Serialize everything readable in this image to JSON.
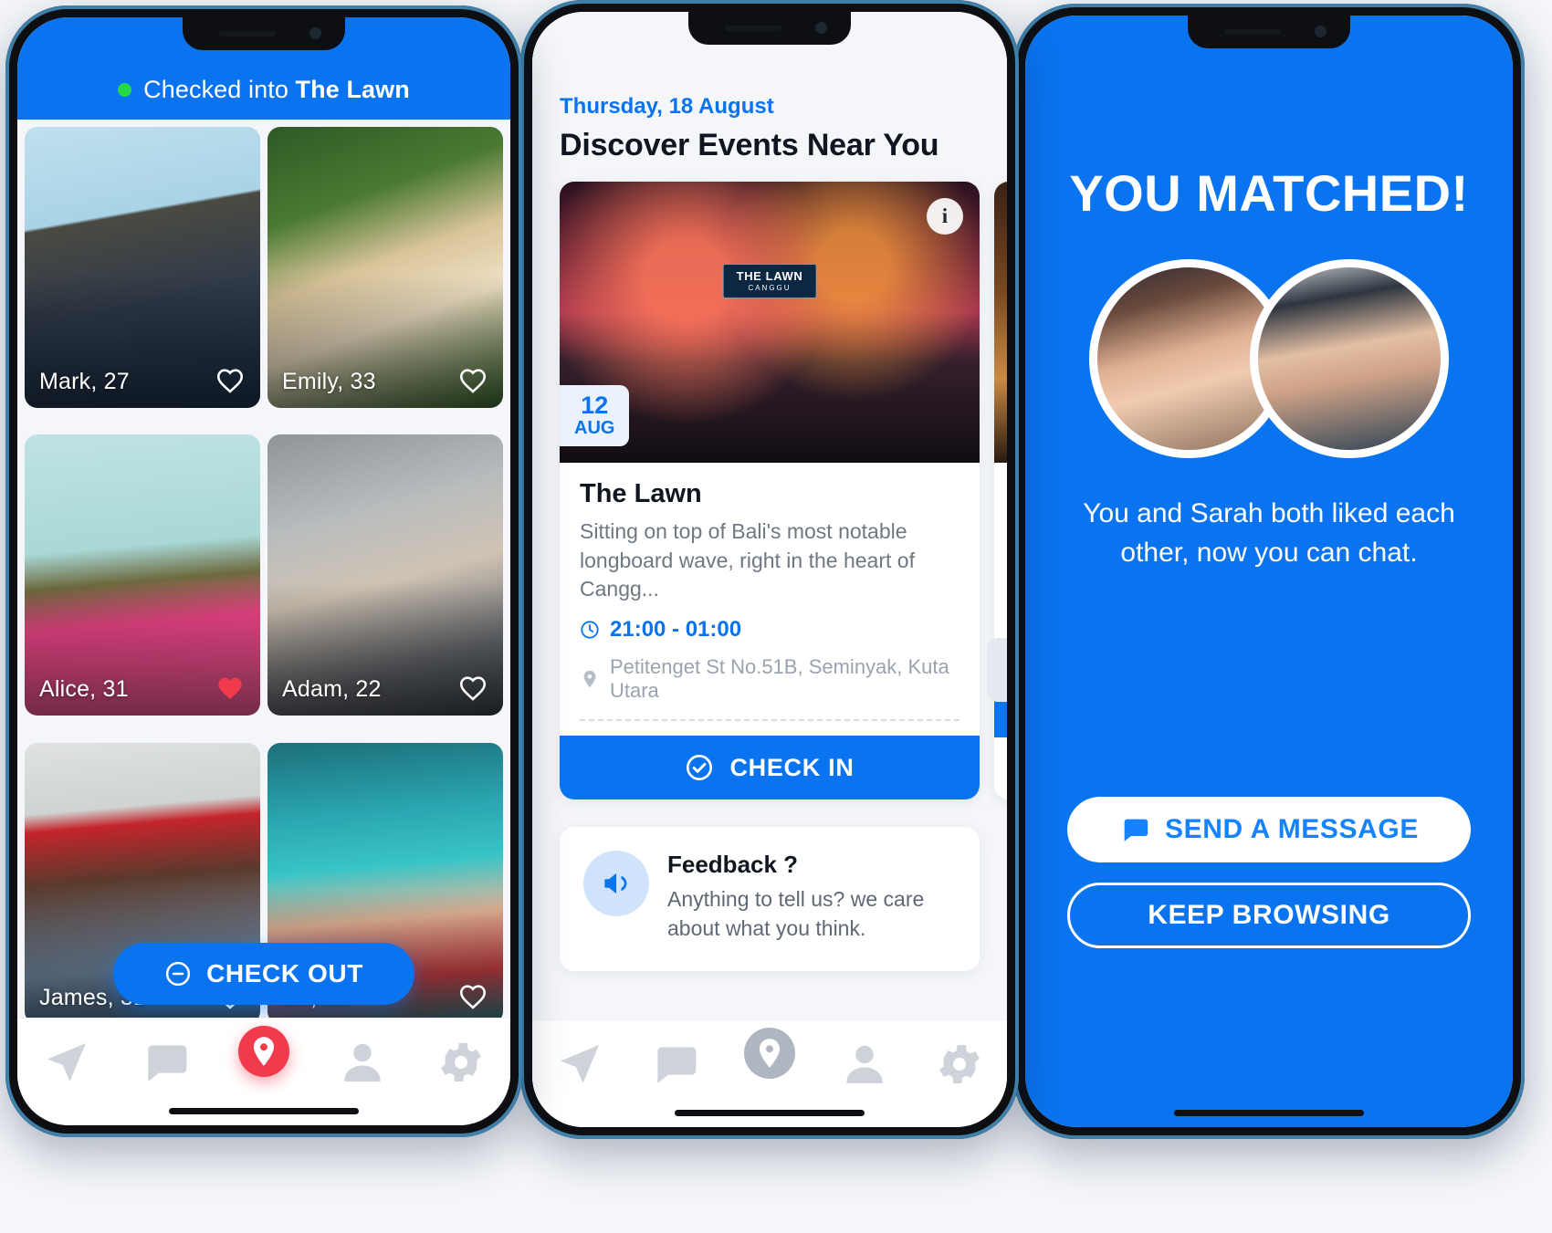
{
  "colors": {
    "brand_blue": "#0a74f0",
    "accent_red": "#f23a4d",
    "status_green": "#26d94a",
    "bg_gray": "#f4f6f9"
  },
  "phone1": {
    "header": {
      "status_prefix": "Checked into",
      "venue": "The Lawn",
      "dot": "status-dot"
    },
    "profiles": [
      {
        "name": "Mark, 27",
        "liked": false,
        "photo": "ph-mark"
      },
      {
        "name": "Emily, 33",
        "liked": false,
        "photo": "ph-emily"
      },
      {
        "name": "Alice, 31",
        "liked": true,
        "photo": "ph-alice"
      },
      {
        "name": "Adam, 22",
        "liked": false,
        "photo": "ph-adam"
      },
      {
        "name": "James, 31",
        "liked": false,
        "photo": "ph-james"
      },
      {
        "name": "Sri, 22",
        "liked": false,
        "photo": "ph-sri"
      }
    ],
    "check_out_label": "CHECK OUT",
    "tabs": [
      {
        "name": "explore",
        "icon": "paper-plane-icon",
        "active": false
      },
      {
        "name": "chat",
        "icon": "chat-bubble-icon",
        "active": false
      },
      {
        "name": "places",
        "icon": "location-pin-icon",
        "active": true
      },
      {
        "name": "profile",
        "icon": "person-icon",
        "active": false
      },
      {
        "name": "settings",
        "icon": "gear-icon",
        "active": false
      }
    ]
  },
  "phone2": {
    "date_label": "Thursday, 18 August",
    "page_title": "Discover Events Near You",
    "event": {
      "badge_day": "12",
      "badge_month": "AUG",
      "stage_sign": "THE LAWN",
      "stage_sign_sub": "CANGGU",
      "info_icon": "info-icon",
      "name": "The Lawn",
      "description": "Sitting on top of Bali's most notable longboard wave, right in the heart of Cangg...",
      "time": "21:00 - 01:00",
      "address": "Petitenget St No.51B, Seminyak, Kuta Utara",
      "check_in_label": "CHECK IN"
    },
    "feedback": {
      "title": "Feedback ?",
      "text": "Anything to tell us? we care about what you think.",
      "icon": "megaphone-icon"
    },
    "tabs": [
      {
        "name": "explore",
        "icon": "paper-plane-icon",
        "active": false
      },
      {
        "name": "chat",
        "icon": "chat-bubble-icon",
        "active": false
      },
      {
        "name": "places",
        "icon": "location-pin-icon",
        "active": true
      },
      {
        "name": "profile",
        "icon": "person-icon",
        "active": false
      },
      {
        "name": "settings",
        "icon": "gear-icon",
        "active": false
      }
    ]
  },
  "phone3": {
    "headline": "YOU MATCHED!",
    "subtext": "You and Sarah both liked each other, now you can chat.",
    "send_message_label": "SEND A MESSAGE",
    "send_message_icon": "chat-bubble-icon",
    "keep_browsing_label": "KEEP BROWSING"
  }
}
